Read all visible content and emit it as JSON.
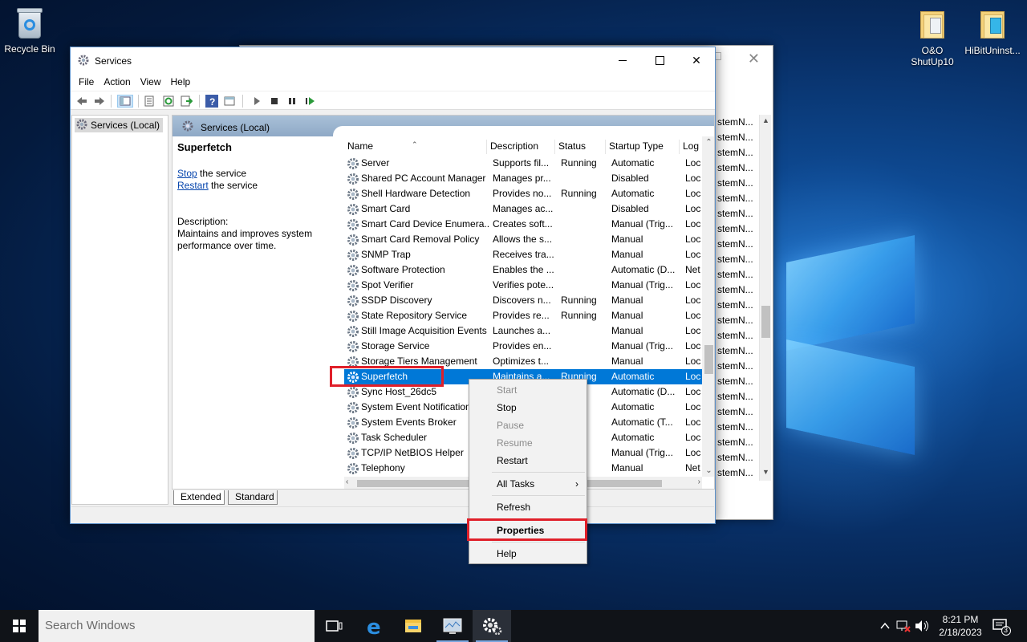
{
  "desktop": {
    "icons": [
      {
        "label": "Recycle Bin"
      },
      {
        "label": "O&O ShutUp10"
      },
      {
        "label": "HiBitUninst..."
      }
    ]
  },
  "background_window": {
    "column_fragments": [
      "stemN...",
      "stemN...",
      "stemN...",
      "stemN...",
      "stemN...",
      "stemN...",
      "stemN...",
      "stemN...",
      "stemN...",
      "stemN...",
      "stemN...",
      "stemN...",
      "stemN...",
      "stemN...",
      "stemN...",
      "stemN...",
      "stemN...",
      "stemN...",
      "stemN...",
      "stemN...",
      "stemN...",
      "stemN...",
      "stemN...",
      "stemN..."
    ]
  },
  "window": {
    "title": "Services",
    "menu": [
      "File",
      "Action",
      "View",
      "Help"
    ],
    "tree_item": "Services (Local)",
    "pane_title": "Services (Local)"
  },
  "detail": {
    "service_name": "Superfetch",
    "stop_link": "Stop",
    "stop_suffix": " the service",
    "restart_link": "Restart",
    "restart_suffix": " the service",
    "description_label": "Description:",
    "description_text": "Maintains and improves system performance over time."
  },
  "list": {
    "columns": [
      "Name",
      "Description",
      "Status",
      "Startup Type",
      "Log"
    ],
    "rows": [
      {
        "name": "Server",
        "desc": "Supports fil...",
        "status": "Running",
        "startup": "Automatic",
        "log": "Loc"
      },
      {
        "name": "Shared PC Account Manager",
        "desc": "Manages pr...",
        "status": "",
        "startup": "Disabled",
        "log": "Loc"
      },
      {
        "name": "Shell Hardware Detection",
        "desc": "Provides no...",
        "status": "Running",
        "startup": "Automatic",
        "log": "Loc"
      },
      {
        "name": "Smart Card",
        "desc": "Manages ac...",
        "status": "",
        "startup": "Disabled",
        "log": "Loc"
      },
      {
        "name": "Smart Card Device Enumera...",
        "desc": "Creates soft...",
        "status": "",
        "startup": "Manual (Trig...",
        "log": "Loc"
      },
      {
        "name": "Smart Card Removal Policy",
        "desc": "Allows the s...",
        "status": "",
        "startup": "Manual",
        "log": "Loc"
      },
      {
        "name": "SNMP Trap",
        "desc": "Receives tra...",
        "status": "",
        "startup": "Manual",
        "log": "Loc"
      },
      {
        "name": "Software Protection",
        "desc": "Enables the ...",
        "status": "",
        "startup": "Automatic (D...",
        "log": "Net"
      },
      {
        "name": "Spot Verifier",
        "desc": "Verifies pote...",
        "status": "",
        "startup": "Manual (Trig...",
        "log": "Loc"
      },
      {
        "name": "SSDP Discovery",
        "desc": "Discovers n...",
        "status": "Running",
        "startup": "Manual",
        "log": "Loc"
      },
      {
        "name": "State Repository Service",
        "desc": "Provides re...",
        "status": "Running",
        "startup": "Manual",
        "log": "Loc"
      },
      {
        "name": "Still Image Acquisition Events",
        "desc": "Launches a...",
        "status": "",
        "startup": "Manual",
        "log": "Loc"
      },
      {
        "name": "Storage Service",
        "desc": "Provides en...",
        "status": "",
        "startup": "Manual (Trig...",
        "log": "Loc"
      },
      {
        "name": "Storage Tiers Management",
        "desc": "Optimizes t...",
        "status": "",
        "startup": "Manual",
        "log": "Loc"
      },
      {
        "name": "Superfetch",
        "desc": "Maintains a...",
        "status": "Running",
        "startup": "Automatic",
        "log": "Loc",
        "selected": true
      },
      {
        "name": "Sync Host_26dc5",
        "desc": "",
        "status": "ng",
        "startup": "Automatic (D...",
        "log": "Loc"
      },
      {
        "name": "System Event Notification",
        "desc": "",
        "status": "ng",
        "startup": "Automatic",
        "log": "Loc"
      },
      {
        "name": "System Events Broker",
        "desc": "",
        "status": "ng",
        "startup": "Automatic (T...",
        "log": "Loc"
      },
      {
        "name": "Task Scheduler",
        "desc": "",
        "status": "ng",
        "startup": "Automatic",
        "log": "Loc"
      },
      {
        "name": "TCP/IP NetBIOS Helper",
        "desc": "",
        "status": "ng",
        "startup": "Manual (Trig...",
        "log": "Loc"
      },
      {
        "name": "Telephony",
        "desc": "",
        "status": "",
        "startup": "Manual",
        "log": "Net"
      }
    ]
  },
  "tabs": [
    "Extended",
    "Standard"
  ],
  "context_menu": {
    "start": "Start",
    "stop": "Stop",
    "pause": "Pause",
    "resume": "Resume",
    "restart": "Restart",
    "all_tasks": "All Tasks",
    "refresh": "Refresh",
    "properties": "Properties",
    "help": "Help"
  },
  "taskbar": {
    "search_placeholder": "Search Windows",
    "time": "8:21 PM",
    "date": "2/18/2023",
    "notification_count": "3"
  },
  "colors": {
    "selection": "#0078d7",
    "highlight_box": "#e0202a",
    "pane_header": "#a9c0d8"
  }
}
